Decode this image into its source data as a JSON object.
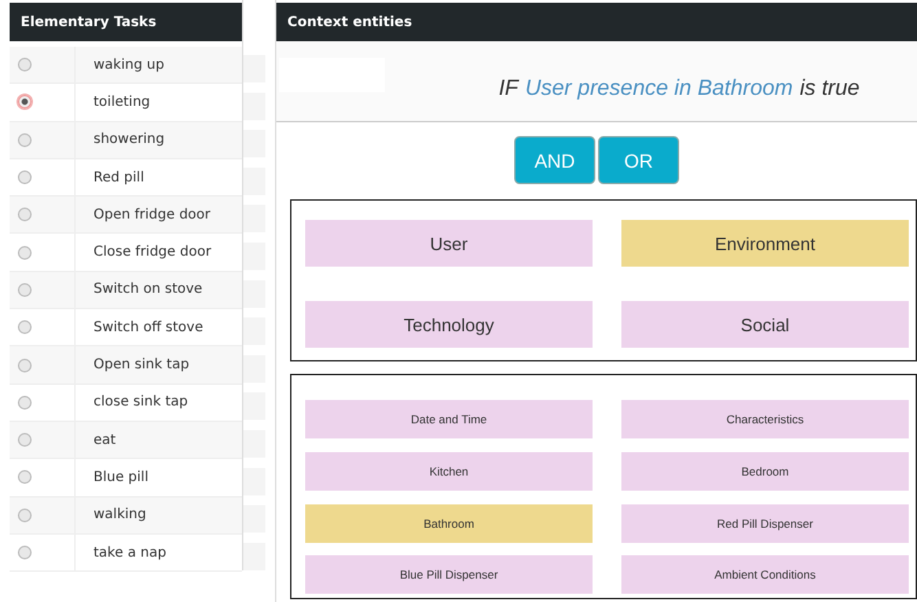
{
  "tasks_panel": {
    "title": "Elementary Tasks",
    "tasks": [
      {
        "label": "waking up",
        "selected": false
      },
      {
        "label": "toileting",
        "selected": true
      },
      {
        "label": "showering",
        "selected": false
      },
      {
        "label": "Red pill",
        "selected": false
      },
      {
        "label": "Open fridge door",
        "selected": false
      },
      {
        "label": "Close fridge door",
        "selected": false
      },
      {
        "label": "Switch on stove",
        "selected": false
      },
      {
        "label": "Switch off stove",
        "selected": false
      },
      {
        "label": "Open sink tap",
        "selected": false
      },
      {
        "label": "close sink tap",
        "selected": false
      },
      {
        "label": "eat",
        "selected": false
      },
      {
        "label": "Blue pill",
        "selected": false
      },
      {
        "label": "walking",
        "selected": false
      },
      {
        "label": "take a nap",
        "selected": false
      }
    ]
  },
  "context_panel": {
    "title": "Context entities",
    "condition": {
      "prefix": "IF",
      "entity": "User presence in Bathroom",
      "suffix": "is true"
    },
    "operators": [
      "AND",
      "OR"
    ],
    "categories": [
      {
        "label": "User",
        "selected": false
      },
      {
        "label": "Environment",
        "selected": true
      },
      {
        "label": "Technology",
        "selected": false
      },
      {
        "label": "Social",
        "selected": false
      }
    ],
    "entities": [
      {
        "label": "Date and Time",
        "selected": false
      },
      {
        "label": "Characteristics",
        "selected": false
      },
      {
        "label": "Kitchen",
        "selected": false
      },
      {
        "label": "Bedroom",
        "selected": false
      },
      {
        "label": "Bathroom",
        "selected": true
      },
      {
        "label": "Red Pill Dispenser",
        "selected": false
      },
      {
        "label": "Blue Pill Dispenser",
        "selected": false
      },
      {
        "label": "Ambient Conditions",
        "selected": false
      }
    ]
  }
}
